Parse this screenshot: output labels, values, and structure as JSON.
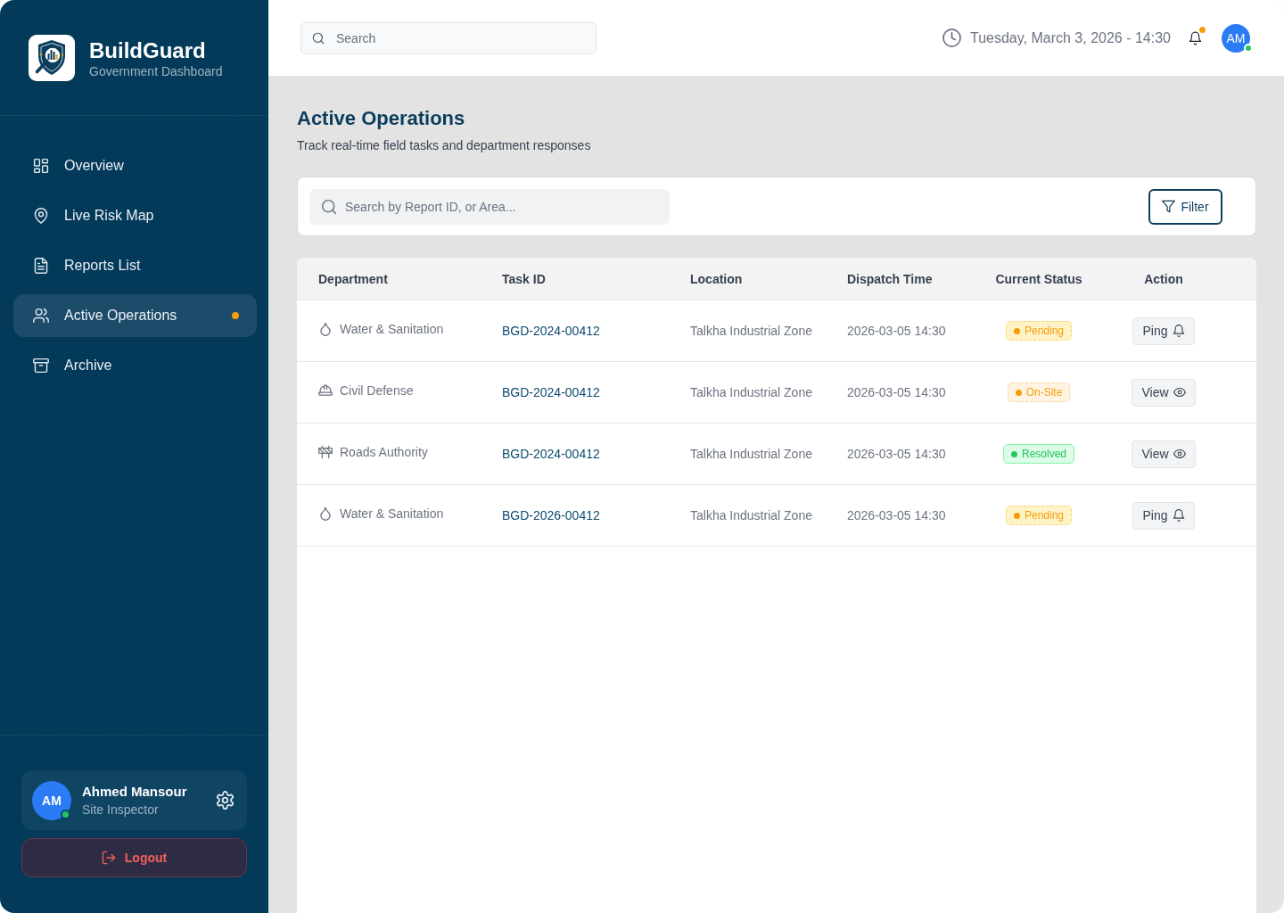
{
  "sidebar": {
    "brand": {
      "name": "BuildGuard",
      "subtitle": "Government Dashboard"
    },
    "nav": [
      {
        "label": "Overview",
        "selected": false,
        "alert": false
      },
      {
        "label": "Live Risk Map",
        "selected": false,
        "alert": false
      },
      {
        "label": "Reports List",
        "selected": false,
        "alert": false
      },
      {
        "label": "Active Operations",
        "selected": true,
        "alert": true
      },
      {
        "label": "Archive",
        "selected": false,
        "alert": false
      }
    ],
    "user": {
      "initials": "AM",
      "name": "Ahmed Mansour",
      "role": "Site Inspector",
      "online": true
    },
    "logout": "Logout"
  },
  "topbar": {
    "search": {
      "placeholder": "Search"
    },
    "datetime": "Tuesday, March 3, 2026 - 14:30",
    "notifications": {
      "unread": true
    },
    "avatar": {
      "initials": "AM",
      "online": true
    }
  },
  "page": {
    "title": "Active Operations",
    "subtitle": "Track real-time field tasks and department responses"
  },
  "toolbar": {
    "search": {
      "placeholder": "Search by Report ID, or Area..."
    },
    "filter": "Filter"
  },
  "table": {
    "columns": [
      "Department",
      "Task ID",
      "Location",
      "Dispatch Time",
      "Current Status",
      "Action"
    ],
    "rows": [
      {
        "department": {
          "kind": "water",
          "name": "Water & Sanitation"
        },
        "task_id": "BGD-2024-00412",
        "location": "Talkha Industrial Zone",
        "dispatch_time": "2026-03-05 14:30",
        "status": {
          "kind": "pending",
          "label": "Pending",
          "color": "#f59e0b"
        },
        "action": {
          "kind": "ping",
          "label": "Ping"
        }
      },
      {
        "department": {
          "kind": "civil_defense",
          "name": "Civil Defense"
        },
        "task_id": "BGD-2024-00412",
        "location": "Talkha Industrial Zone",
        "dispatch_time": "2026-03-05 14:30",
        "status": {
          "kind": "onsite",
          "label": "On-Site",
          "color": "#f59e0b"
        },
        "action": {
          "kind": "view",
          "label": "View"
        }
      },
      {
        "department": {
          "kind": "roads",
          "name": "Roads Authority"
        },
        "task_id": "BGD-2024-00412",
        "location": "Talkha Industrial Zone",
        "dispatch_time": "2026-03-05 14:30",
        "status": {
          "kind": "resolved",
          "label": "Resolved",
          "color": "#22c55e"
        },
        "action": {
          "kind": "view",
          "label": "View"
        }
      },
      {
        "department": {
          "kind": "water",
          "name": "Water & Sanitation"
        },
        "task_id": "BGD-2026-00412",
        "location": "Talkha Industrial Zone",
        "dispatch_time": "2026-03-05 14:30",
        "status": {
          "kind": "pending",
          "label": "Pending",
          "color": "#f59e0b"
        },
        "action": {
          "kind": "ping",
          "label": "Ping"
        }
      }
    ]
  }
}
